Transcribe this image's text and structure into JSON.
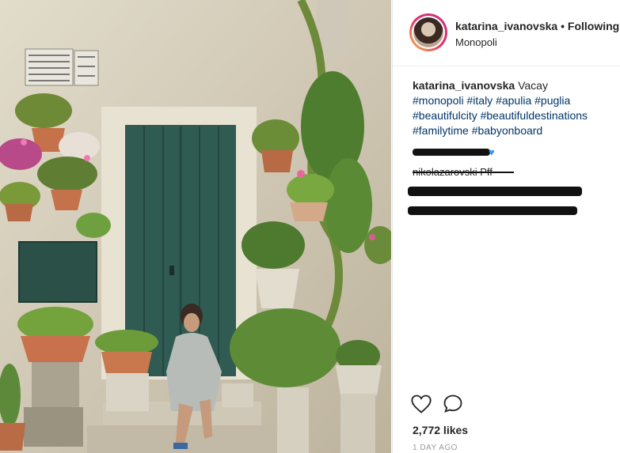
{
  "post": {
    "author": "katarina_ivanovska",
    "separator": "•",
    "follow_label": "Following",
    "location": "Monopoli",
    "photo_alt": "woman sitting in front of green door with potted plants",
    "sign_text": "I SIGNORI CANI SONO PREGATI DI PORTARE A FARE LA PIPI' I PADRONI"
  },
  "caption": {
    "username": "katarina_ivanovska",
    "text": "Vacay",
    "hashtags": [
      "#monopoli",
      "#italy",
      "#apulia",
      "#puglia",
      "#beautifulcity",
      "#beautifuldestinations",
      "#familytime",
      "#babyonboard"
    ]
  },
  "comments": [
    {
      "text": "                "
    },
    {
      "text": "nikolazarovski Pff"
    },
    {
      "text": "                "
    },
    {
      "text": "                "
    }
  ],
  "actions": {
    "like_icon": "heart-icon",
    "comment_icon": "speech-bubble-icon"
  },
  "stats": {
    "likes": "2,772 likes",
    "timestamp": "1 DAY AGO"
  }
}
